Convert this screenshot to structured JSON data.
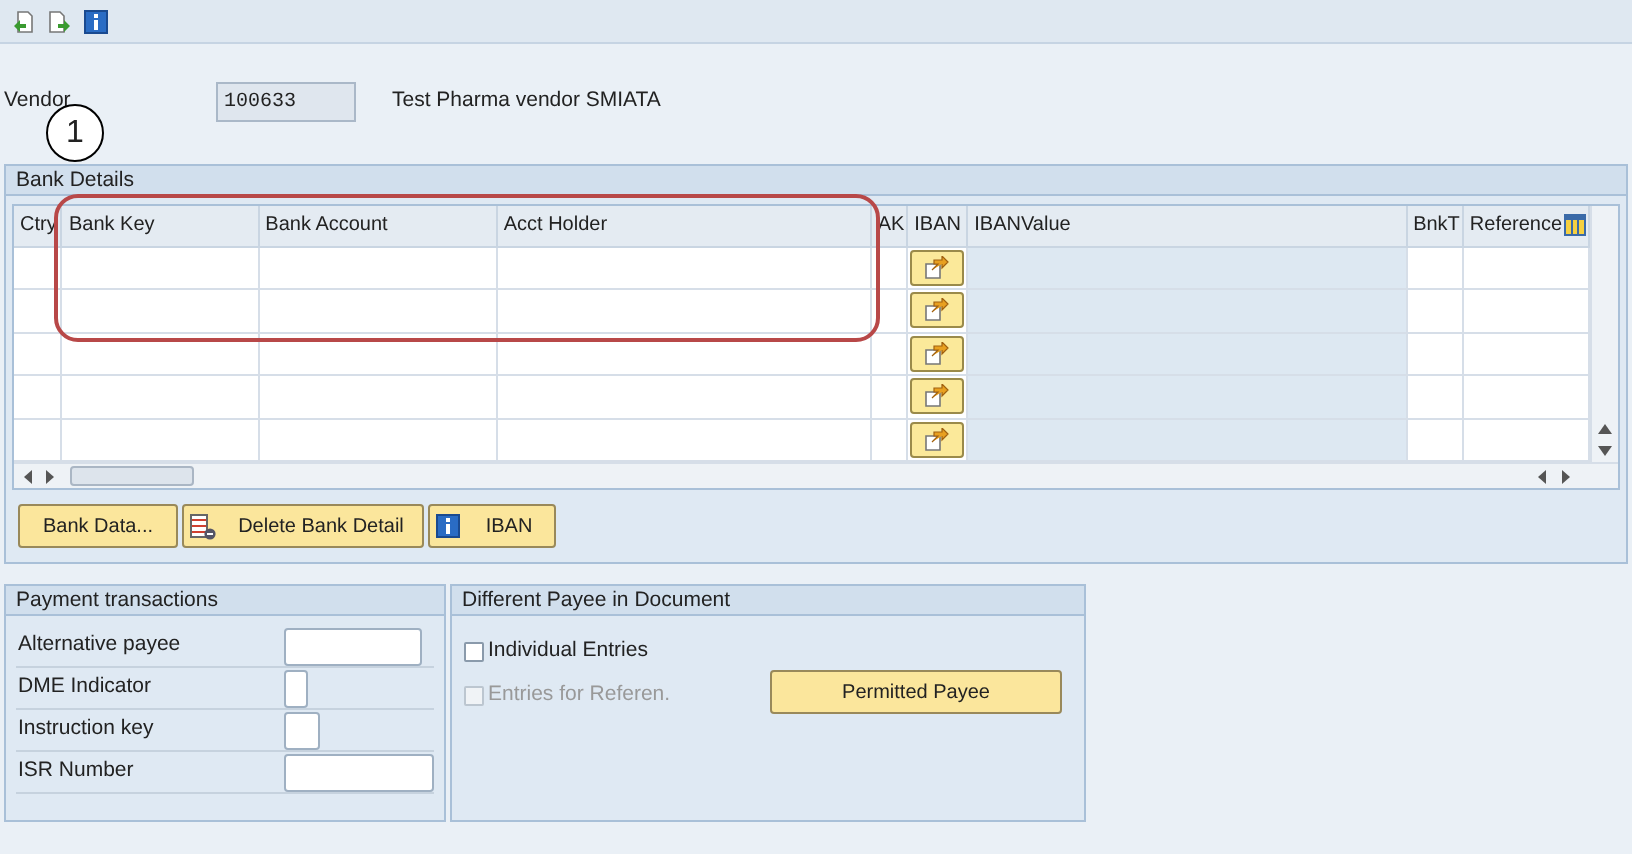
{
  "vendor": {
    "label": "Vendor",
    "number": "100633",
    "name": "Test Pharma vendor SMIATA"
  },
  "bank_details": {
    "title": "Bank Details",
    "columns": [
      {
        "label": "Ctry",
        "kind": "input"
      },
      {
        "label": "Bank Key",
        "kind": "input"
      },
      {
        "label": "Bank Account",
        "kind": "input"
      },
      {
        "label": "Acct Holder",
        "kind": "input"
      },
      {
        "label": "AK",
        "kind": "input"
      },
      {
        "label": "IBAN",
        "kind": "button"
      },
      {
        "label": "IBANValue",
        "kind": "readonly"
      },
      {
        "label": "BnkT",
        "kind": "input"
      },
      {
        "label": "Reference",
        "kind": "input"
      }
    ],
    "buttons": [
      {
        "label": "Bank Data...",
        "kind": "plain"
      },
      {
        "label": "Delete Bank Detail",
        "kind": "delete"
      },
      {
        "label": "IBAN",
        "kind": "info"
      }
    ]
  },
  "payment_transactions": {
    "title": "Payment transactions",
    "fields": [
      {
        "label": "Alternative payee"
      },
      {
        "label": "DME Indicator"
      },
      {
        "label": "Instruction key"
      },
      {
        "label": "ISR Number"
      }
    ]
  },
  "different_payee": {
    "title": "Different Payee in Document",
    "checkboxes": [
      {
        "label": "Individual Entries",
        "checked": false,
        "disabled": false
      },
      {
        "label": "Entries for Referen.",
        "checked": false,
        "disabled": true
      }
    ],
    "button": "Permitted Payee"
  },
  "annotation": {
    "label": "1"
  }
}
